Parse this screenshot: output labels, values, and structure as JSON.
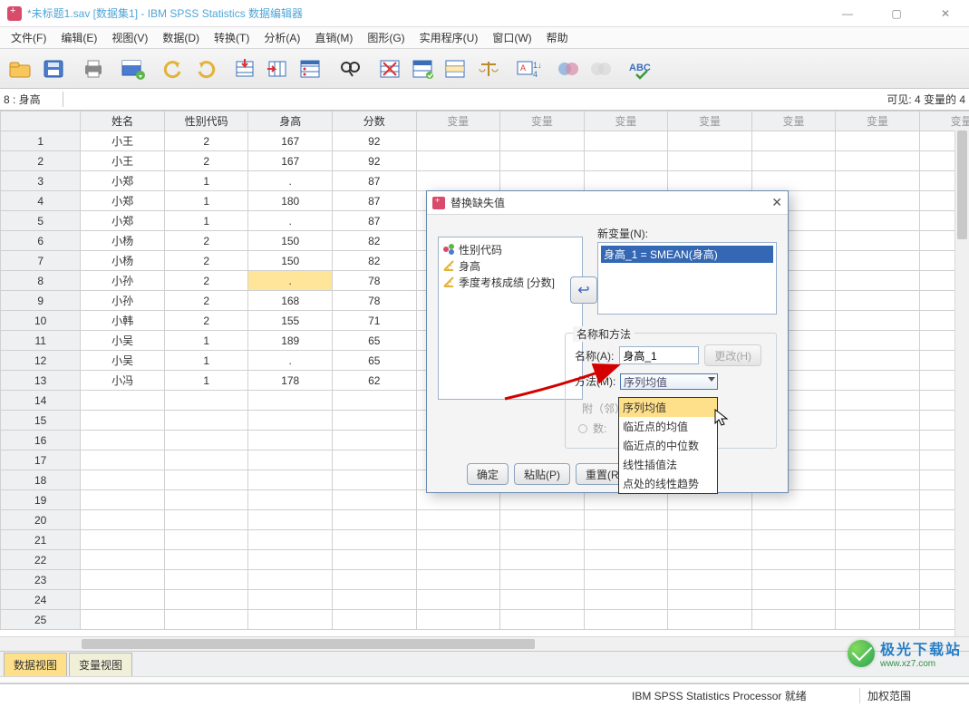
{
  "window": {
    "title": "*未标题1.sav [数据集1] - IBM SPSS Statistics 数据编辑器"
  },
  "menu": [
    "文件(F)",
    "编辑(E)",
    "视图(V)",
    "数据(D)",
    "转换(T)",
    "分析(A)",
    "直销(M)",
    "图形(G)",
    "实用程序(U)",
    "窗口(W)",
    "帮助"
  ],
  "cell_ref": {
    "label": "8 : 身高",
    "value": "",
    "visible": "可见:   4 变量的 4"
  },
  "columns": [
    "姓名",
    "性别代码",
    "身高",
    "分数"
  ],
  "placeholder_col": "变量",
  "rows": [
    {
      "n": "1",
      "c": [
        "小王",
        "2",
        "167",
        "92"
      ]
    },
    {
      "n": "2",
      "c": [
        "小王",
        "2",
        "167",
        "92"
      ]
    },
    {
      "n": "3",
      "c": [
        "小郑",
        "1",
        ".",
        "87"
      ]
    },
    {
      "n": "4",
      "c": [
        "小郑",
        "1",
        "180",
        "87"
      ]
    },
    {
      "n": "5",
      "c": [
        "小郑",
        "1",
        ".",
        "87"
      ]
    },
    {
      "n": "6",
      "c": [
        "小杨",
        "2",
        "150",
        "82"
      ]
    },
    {
      "n": "7",
      "c": [
        "小杨",
        "2",
        "150",
        "82"
      ]
    },
    {
      "n": "8",
      "c": [
        "小孙",
        "2",
        ".",
        "78"
      ],
      "hl": 2
    },
    {
      "n": "9",
      "c": [
        "小孙",
        "2",
        "168",
        "78"
      ]
    },
    {
      "n": "10",
      "c": [
        "小韩",
        "2",
        "155",
        "71"
      ]
    },
    {
      "n": "11",
      "c": [
        "小吴",
        "1",
        "189",
        "65"
      ]
    },
    {
      "n": "12",
      "c": [
        "小吴",
        "1",
        ".",
        "65"
      ]
    },
    {
      "n": "13",
      "c": [
        "小冯",
        "1",
        "178",
        "62"
      ]
    }
  ],
  "chart_data": {
    "type": "table",
    "columns": [
      "姓名",
      "性别代码",
      "身高",
      "分数"
    ],
    "data": [
      [
        "小王",
        2,
        167,
        92
      ],
      [
        "小王",
        2,
        167,
        92
      ],
      [
        "小郑",
        1,
        null,
        87
      ],
      [
        "小郑",
        1,
        180,
        87
      ],
      [
        "小郑",
        1,
        null,
        87
      ],
      [
        "小杨",
        2,
        150,
        82
      ],
      [
        "小杨",
        2,
        150,
        82
      ],
      [
        "小孙",
        2,
        null,
        78
      ],
      [
        "小孙",
        2,
        168,
        78
      ],
      [
        "小韩",
        2,
        155,
        71
      ],
      [
        "小吴",
        1,
        189,
        65
      ],
      [
        "小吴",
        1,
        null,
        65
      ],
      [
        "小冯",
        1,
        178,
        62
      ]
    ]
  },
  "tabs": {
    "data_view": "数据视图",
    "var_view": "变量视图"
  },
  "status": {
    "processor": "IBM SPSS Statistics Processor 就绪",
    "weight": "加权范围"
  },
  "dialog": {
    "title": "替换缺失值",
    "vars": [
      "性别代码",
      "身高",
      "季度考核成绩 [分数]"
    ],
    "newvar_label": "新变量(N):",
    "newvar_item": "身高_1 = SMEAN(身高)",
    "group_legend": "名称和方法",
    "name_label": "名称(A):",
    "name_value": "身高_1",
    "change_btn": "更改(H)",
    "method_label": "方法(M):",
    "method_value": "序列均值",
    "neighbor_label": "附（邻）:",
    "number_label": "数:",
    "buttons": [
      "确定",
      "粘贴(P)",
      "重置(R)"
    ],
    "dropdown": [
      "序列均值",
      "临近点的均值",
      "临近点的中位数",
      "线性插值法",
      "点处的线性趋势"
    ]
  },
  "watermark": {
    "cn": "极光下载站",
    "url": "www.xz7.com"
  }
}
